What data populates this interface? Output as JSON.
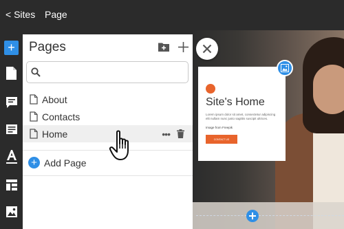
{
  "topbar": {
    "back_label": "< Sites",
    "breadcrumb": "Page"
  },
  "rail": {
    "items": [
      {
        "icon": "add-icon",
        "active": true
      },
      {
        "icon": "page-icon"
      },
      {
        "icon": "comment-icon"
      },
      {
        "icon": "text-block-icon"
      },
      {
        "icon": "typography-icon"
      },
      {
        "icon": "layout-icon"
      },
      {
        "icon": "image-icon"
      }
    ]
  },
  "panel": {
    "title": "Pages",
    "search": {
      "placeholder": "",
      "value": ""
    },
    "pages": [
      {
        "label": "About"
      },
      {
        "label": "Contacts"
      },
      {
        "label": "Home",
        "selected": true
      }
    ],
    "add_page_label": "Add Page"
  },
  "preview": {
    "card": {
      "title": "Site's Home",
      "body": "Lorem ipsum dolor sit amet, consectetur adipiscing elit nullam nunc justo sagittis suscipit ultrices.",
      "credit": "Image from Freepik",
      "cta_label": "CONTACT US"
    }
  },
  "colors": {
    "accent": "#2f8fe6",
    "brand_orange": "#e8642c",
    "chrome": "#2b2b2b"
  }
}
